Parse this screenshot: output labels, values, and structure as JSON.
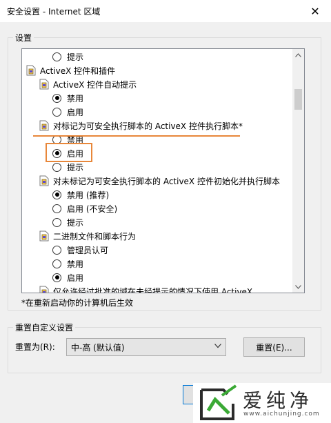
{
  "window": {
    "title": "安全设置 - Internet 区域",
    "close_glyph": "✕"
  },
  "settings_group": {
    "label": "设置"
  },
  "tree": [
    {
      "kind": "radio",
      "label": "提示",
      "checked": false
    },
    {
      "kind": "doc",
      "label": "ActiveX 控件和插件"
    },
    {
      "kind": "doc",
      "label": "ActiveX 控件自动提示"
    },
    {
      "kind": "radio",
      "label": "禁用",
      "checked": true
    },
    {
      "kind": "radio",
      "label": "启用",
      "checked": false
    },
    {
      "kind": "doc",
      "label": "对标记为可安全执行脚本的 ActiveX 控件执行脚本*"
    },
    {
      "kind": "radio",
      "label": "禁用",
      "checked": false
    },
    {
      "kind": "radio",
      "label": "启用",
      "checked": true
    },
    {
      "kind": "radio",
      "label": "提示",
      "checked": false
    },
    {
      "kind": "doc",
      "label": "对未标记为可安全执行脚本的 ActiveX 控件初始化并执行脚本"
    },
    {
      "kind": "radio",
      "label": "禁用 (推荐)",
      "checked": true
    },
    {
      "kind": "radio",
      "label": "启用 (不安全)",
      "checked": false
    },
    {
      "kind": "radio",
      "label": "提示",
      "checked": false
    },
    {
      "kind": "doc",
      "label": "二进制文件和脚本行为"
    },
    {
      "kind": "radio",
      "label": "管理员认可",
      "checked": false
    },
    {
      "kind": "radio",
      "label": "禁用",
      "checked": false
    },
    {
      "kind": "radio",
      "label": "启用",
      "checked": true
    },
    {
      "kind": "doc",
      "label": "仅允许经过批准的域在未经提示的情况下使用 ActiveX"
    }
  ],
  "note": "*在重新启动你的计算机后生效",
  "reset_group": {
    "label": "重置自定义设置",
    "reset_to_label": "重置为(R):",
    "select_value": "中-高 (默认值)",
    "reset_button": "重置(E)..."
  },
  "watermark": {
    "brand": "爱纯净",
    "url": "www.aichunjing.com"
  },
  "colors": {
    "highlight": "#e8873a",
    "selection_border": "#828790"
  }
}
